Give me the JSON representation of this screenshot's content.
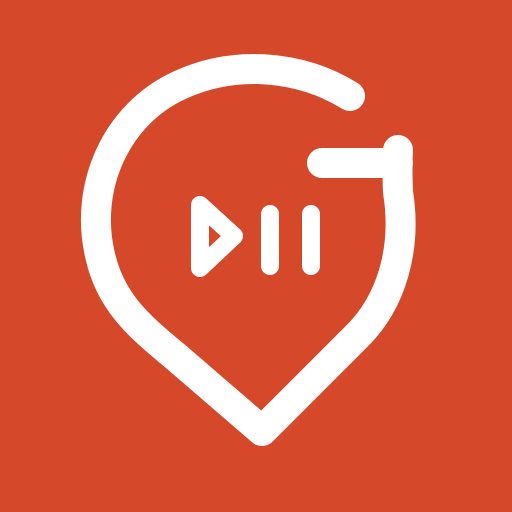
{
  "app_icon": {
    "name": "location-pin-play-pause-logo",
    "colors": {
      "background": "#D6482A",
      "foreground": "#FFFFFF"
    },
    "icons": [
      "map-pin-outline-icon",
      "play-icon",
      "pause-icon"
    ]
  }
}
